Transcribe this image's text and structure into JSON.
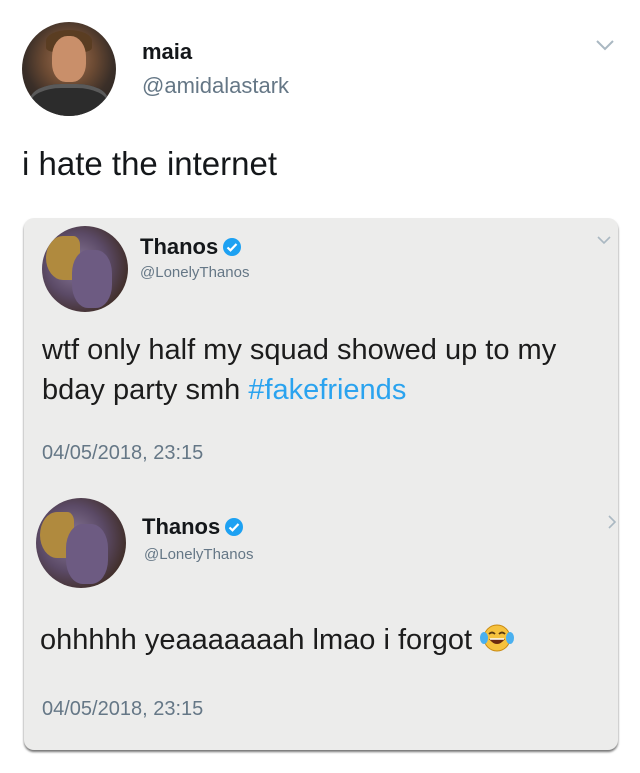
{
  "post": {
    "display_name": "maia",
    "handle": "@amidalastark",
    "text": "i hate the internet"
  },
  "quoted": [
    {
      "name": "Thanos",
      "handle": "@LonelyThanos",
      "text_plain": "wtf only half my squad showed up to my bday party smh ",
      "hashtag": "#fakefriends",
      "timestamp": "04/05/2018, 23:15"
    },
    {
      "name": "Thanos",
      "handle": "@LonelyThanos",
      "text_plain": "ohhhhh yeaaaaaaah lmao i forgot",
      "emoji": "tears-of-joy-emoji",
      "timestamp": "04/05/2018, 23:15"
    }
  ],
  "icons": {
    "chevron": "chevron-down-icon",
    "verified": "verified-badge-icon"
  },
  "colors": {
    "link": "#2aa3ef",
    "verified": "#1da1f2",
    "muted": "#657786",
    "card_bg": "#ececeb"
  }
}
